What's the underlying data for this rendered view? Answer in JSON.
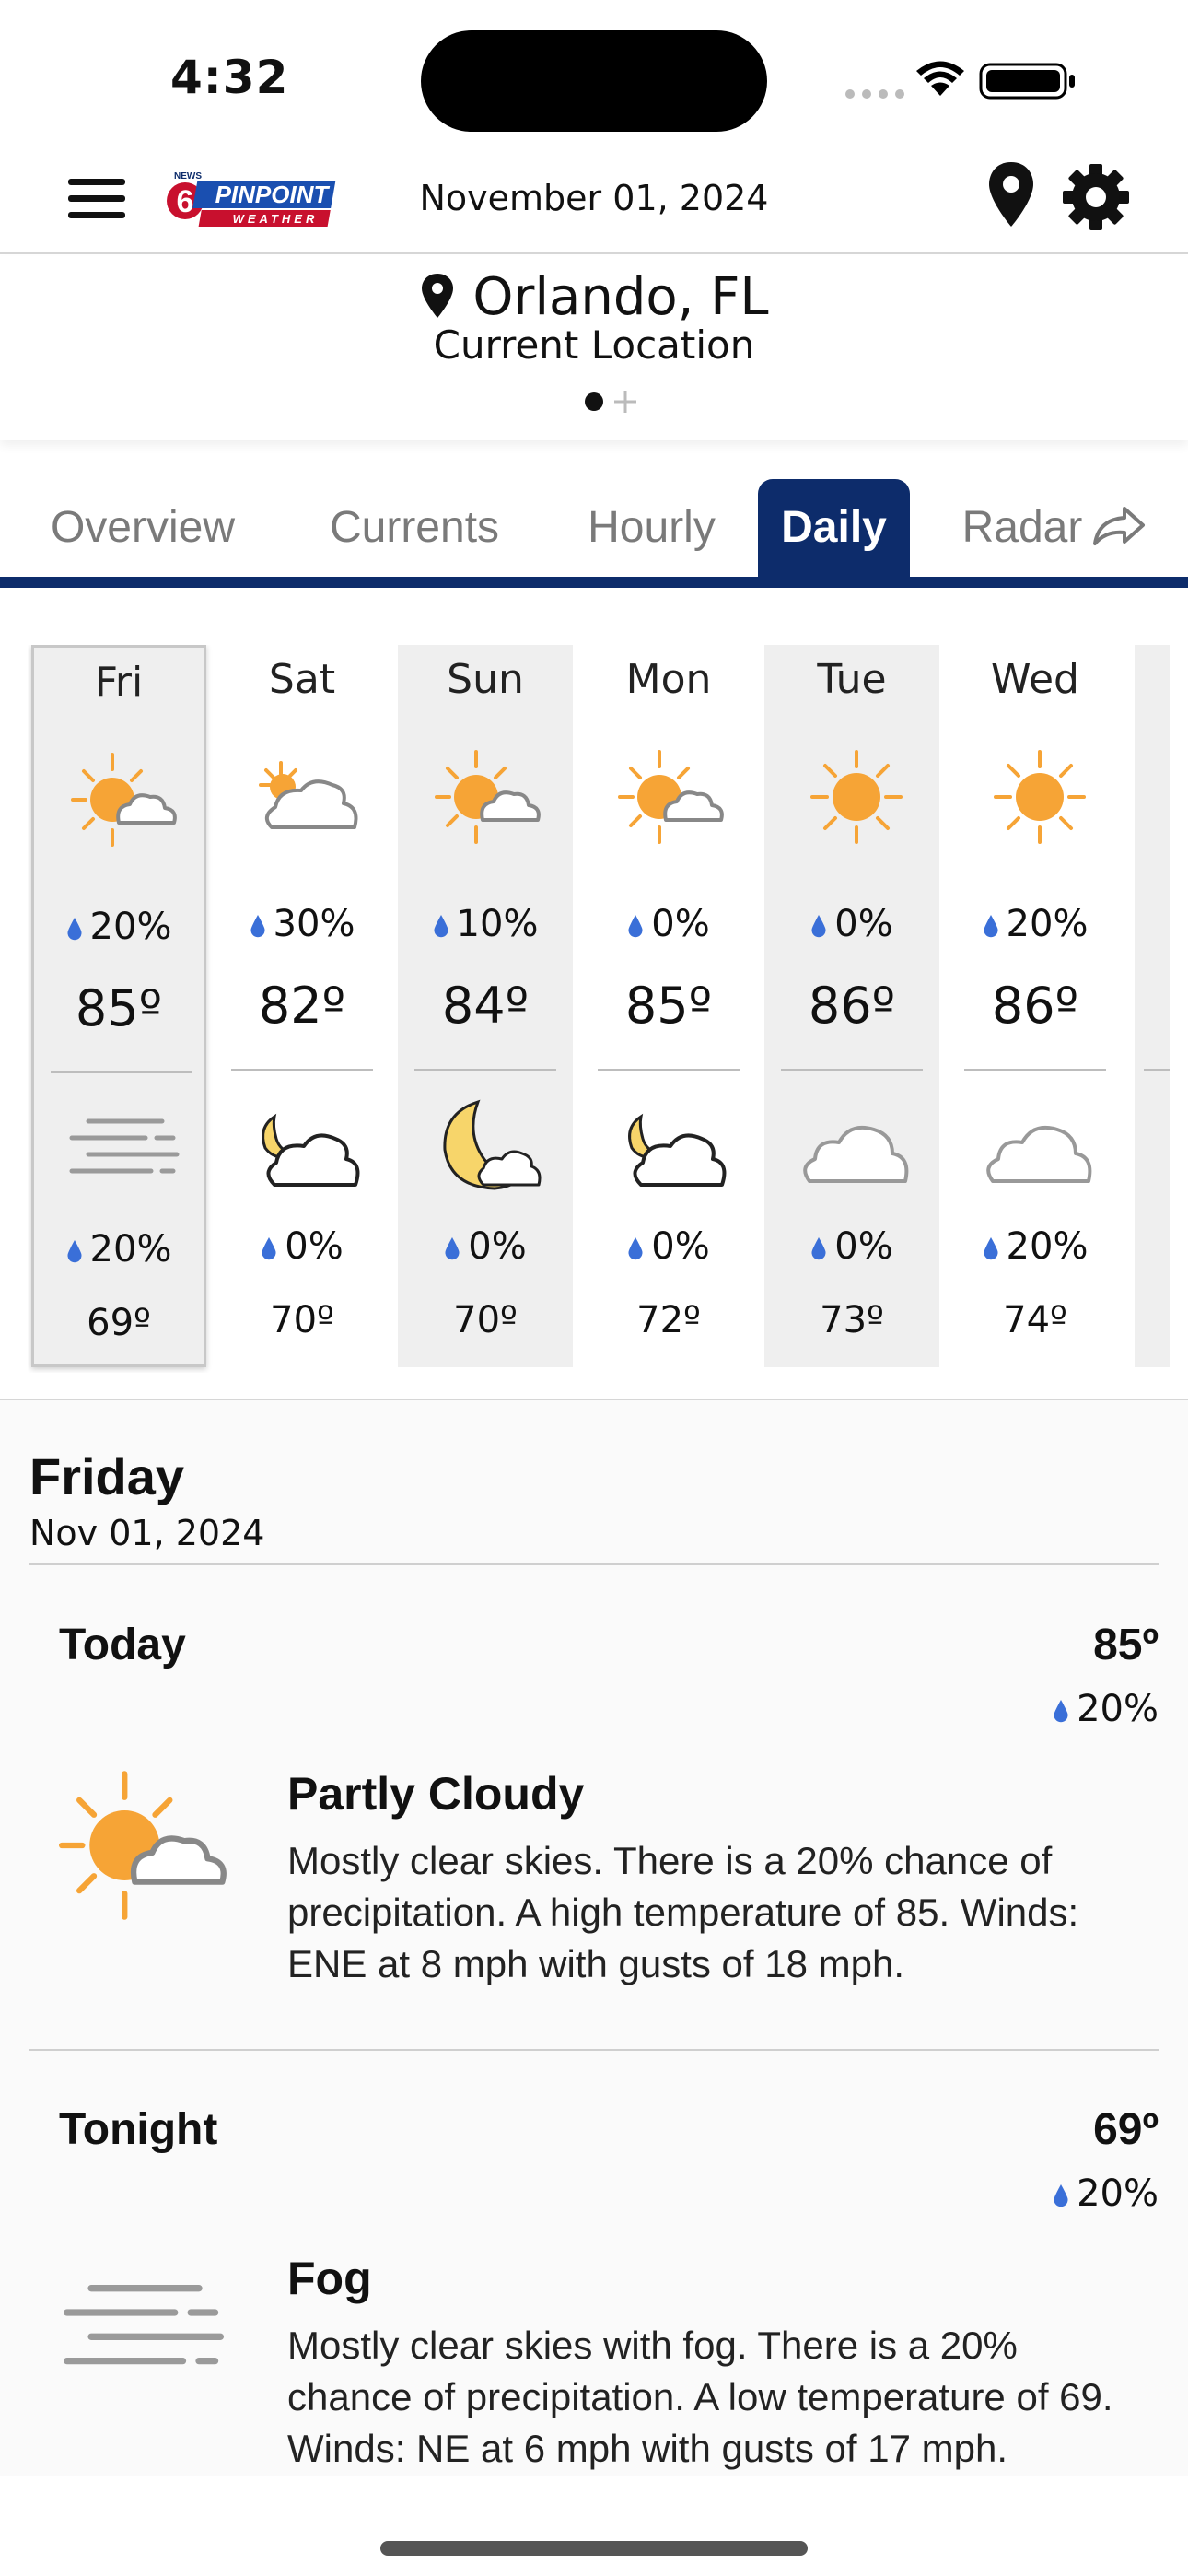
{
  "status": {
    "time": "4:32"
  },
  "header": {
    "date": "November 01, 2024",
    "logo_alt": "News 6 Pinpoint Weather"
  },
  "location": {
    "name": "Orlando, FL",
    "subtitle": "Current Location"
  },
  "tabs": [
    {
      "label": "Overview",
      "active": false
    },
    {
      "label": "Currents",
      "active": false
    },
    {
      "label": "Hourly",
      "active": false
    },
    {
      "label": "Daily",
      "active": true
    },
    {
      "label": "Radar",
      "active": false
    }
  ],
  "days": [
    {
      "name": "Fri",
      "day_icon": "partly-cloudy-day-icon",
      "day_precip": "20%",
      "high": "85º",
      "night_icon": "fog-icon",
      "night_precip": "20%",
      "low": "69º"
    },
    {
      "name": "Sat",
      "day_icon": "mostly-cloudy-day-icon",
      "day_precip": "30%",
      "high": "82º",
      "night_icon": "partly-cloudy-night-icon",
      "night_precip": "0%",
      "low": "70º"
    },
    {
      "name": "Sun",
      "day_icon": "partly-cloudy-day-icon",
      "day_precip": "10%",
      "high": "84º",
      "night_icon": "mostly-clear-night-icon",
      "night_precip": "0%",
      "low": "70º"
    },
    {
      "name": "Mon",
      "day_icon": "partly-cloudy-day-icon",
      "day_precip": "0%",
      "high": "85º",
      "night_icon": "partly-cloudy-night-icon",
      "night_precip": "0%",
      "low": "72º"
    },
    {
      "name": "Tue",
      "day_icon": "sunny-icon",
      "day_precip": "0%",
      "high": "86º",
      "night_icon": "cloudy-icon",
      "night_precip": "0%",
      "low": "73º"
    },
    {
      "name": "Wed",
      "day_icon": "sunny-icon",
      "day_precip": "20%",
      "high": "86º",
      "night_icon": "cloudy-icon",
      "night_precip": "20%",
      "low": "74º"
    }
  ],
  "detail": {
    "day": "Friday",
    "date": "Nov 01, 2024",
    "periods": [
      {
        "name": "Today",
        "temp": "85º",
        "precip": "20%",
        "icon": "partly-cloudy-day-icon",
        "condition": "Partly Cloudy",
        "text": "Mostly clear skies. There is a 20% chance of precipitation. A high temperature of 85. Winds: ENE at 8 mph with gusts of 18 mph."
      },
      {
        "name": "Tonight",
        "temp": "69º",
        "precip": "20%",
        "icon": "fog-icon",
        "condition": "Fog",
        "text": "Mostly clear skies with fog. There is a 20% chance of precipitation. A low temperature of 69. Winds: NE at 6 mph with gusts of 17 mph."
      }
    ]
  },
  "colors": {
    "accent": "#0d2c6b",
    "sun": "#f6a436",
    "moon": "#f7d56a",
    "drop": "#3a6fd8",
    "cloud_stroke": "#888888"
  }
}
